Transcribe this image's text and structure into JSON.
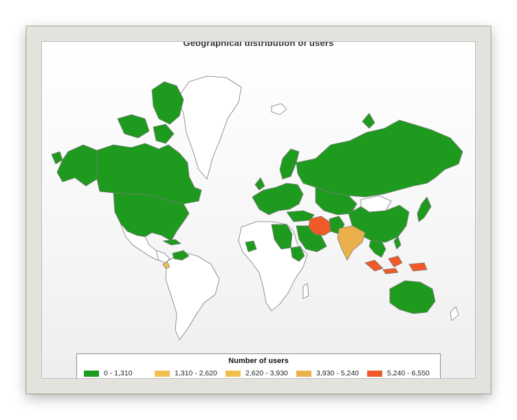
{
  "title": "Geographical distribution of users",
  "legend": {
    "title": "Number of users",
    "items": [
      {
        "label": "0 - 1,310",
        "color": "#1e9a1e"
      },
      {
        "label": "1,310 - 2,620",
        "color": "#f0bf50"
      },
      {
        "label": "2,620 - 3,930",
        "color": "#f0bf50"
      },
      {
        "label": "3,930 - 5,240",
        "color": "#e9b04c"
      },
      {
        "label": "5,240 - 6,550",
        "color": "#f05a28"
      }
    ]
  },
  "map": {
    "ocean_color": "#ffffff",
    "border_color": "#7a7a7a",
    "no_data_color": "#ffffff",
    "countries_low": [
      "Canada",
      "United States",
      "Alaska",
      "Mexico (north)",
      "Western Europe",
      "Scandinavia",
      "Russia",
      "Turkey",
      "Kazakhstan",
      "Arabian Peninsula",
      "Egypt",
      "Sudan",
      "Libya",
      "Algeria",
      "Nigeria",
      "Ethiopia",
      "Pakistan",
      "Afghanistan",
      "China",
      "Mongolia",
      "Japan",
      "Korea",
      "Southeast Asia",
      "Philippines",
      "Australia",
      "Venezuela",
      "Cuba"
    ],
    "countries_mid": [
      "India"
    ],
    "countries_high": [
      "Iran",
      "Indonesia"
    ]
  }
}
